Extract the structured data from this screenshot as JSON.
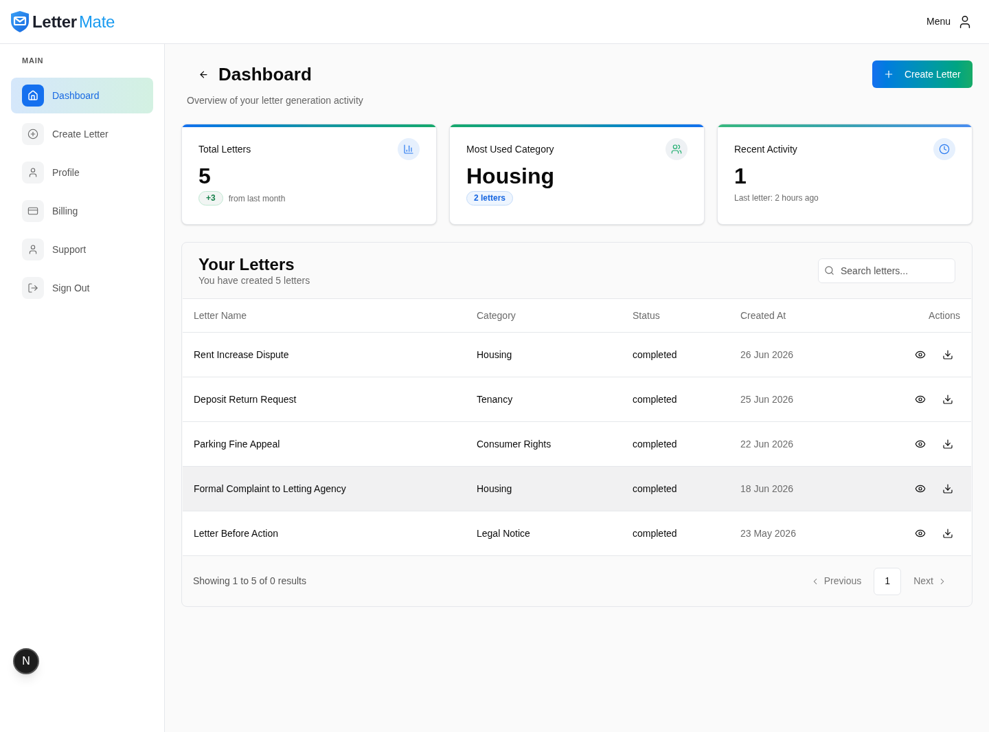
{
  "header": {
    "logo": {
      "part_1": "Letter",
      "part_2": "Mate"
    },
    "menu_label": "Menu"
  },
  "sidebar": {
    "section_label": "MAIN",
    "items": [
      {
        "label": "Dashboard",
        "selected": true
      },
      {
        "label": "Create Letter",
        "selected": false
      },
      {
        "label": "Profile",
        "selected": false
      },
      {
        "label": "Billing",
        "selected": false
      },
      {
        "label": "Support",
        "selected": false
      },
      {
        "label": "Sign Out",
        "selected": false
      }
    ]
  },
  "page": {
    "title": "Dashboard",
    "subtitle": "Overview of your letter generation activity",
    "create_button": "Create Letter"
  },
  "stats": [
    {
      "kind": "trend",
      "label": "Total Letters",
      "value": "5",
      "badge": "+3",
      "note": "from last month"
    },
    {
      "kind": "category",
      "label": "Most Used Category",
      "value": "Housing",
      "badge": "2 letters"
    },
    {
      "kind": "activity",
      "label": "Recent Activity",
      "value": "1",
      "note": "Last letter: 2 hours ago"
    }
  ],
  "letters": {
    "title": "Your Letters",
    "subtitle": "You have created 5 letters",
    "search": {
      "placeholder": "Search letters..."
    },
    "columns": [
      "Letter Name",
      "Category",
      "Status",
      "Created At",
      "Actions"
    ],
    "rows": [
      {
        "name": "Rent Increase Dispute",
        "category": "Housing",
        "status": "completed",
        "created_at": "26 Jun 2026",
        "highlighted": false
      },
      {
        "name": "Deposit Return Request",
        "category": "Tenancy",
        "status": "completed",
        "created_at": "25 Jun 2026",
        "highlighted": false
      },
      {
        "name": "Parking Fine Appeal",
        "category": "Consumer Rights",
        "status": "completed",
        "created_at": "22 Jun 2026",
        "highlighted": false
      },
      {
        "name": "Formal Complaint to Letting Agency",
        "category": "Housing",
        "status": "completed",
        "created_at": "18 Jun 2026",
        "highlighted": true
      },
      {
        "name": "Letter Before Action",
        "category": "Legal Notice",
        "status": "completed",
        "created_at": "23 May 2026",
        "highlighted": false
      }
    ],
    "footer": {
      "summary": "Showing 1 to 5 of 0 results",
      "previous": "Previous",
      "pages": [
        {
          "label": "1",
          "selected": true
        }
      ],
      "next": "Next"
    }
  },
  "dev_badge": "N"
}
